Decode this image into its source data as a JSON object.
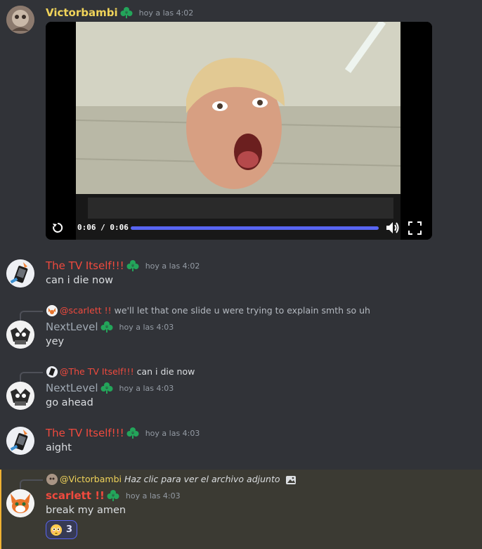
{
  "messages": [
    {
      "author": "Victorbambi",
      "author_color": "#f0d35a",
      "timestamp": "hoy a las 4:02",
      "video": {
        "current_time": "0:06",
        "separator": "/",
        "duration": "0:06",
        "progress": 1.0
      }
    },
    {
      "author": "The TV Itself!!!",
      "author_color": "#f04a3e",
      "timestamp": "hoy a las 4:02",
      "text": "can i die now"
    },
    {
      "reply": {
        "name": "@scarlett !!",
        "name_color": "#f04a3e",
        "text": "we'll let that one slide u were trying to explain smth so uh"
      },
      "author": "NextLevel",
      "author_color": "#a0a9b3",
      "timestamp": "hoy a las 4:03",
      "text": "yey"
    },
    {
      "reply": {
        "name": "@The TV Itself!!!",
        "name_color": "#f04a3e",
        "text": "can i die now"
      },
      "author": "NextLevel",
      "author_color": "#a0a9b3",
      "timestamp": "hoy a las 4:03",
      "text": "go ahead"
    },
    {
      "author": "The TV Itself!!!",
      "author_color": "#f04a3e",
      "timestamp": "hoy a las 4:03",
      "text": "aight"
    },
    {
      "reply": {
        "name": "@Victorbambi",
        "name_color": "#f0d35a",
        "text": "Haz clic para ver el archivo adjunto"
      },
      "author": "scarlett !!",
      "author_color": "#f04a3e",
      "timestamp": "hoy a las 4:03",
      "text": "break my amen",
      "reaction": {
        "emoji": "flushed-face",
        "count": "3"
      }
    }
  ],
  "colors": {
    "accent": "#5865f2",
    "badge": "#23a55a",
    "mention_highlight": "#f0b232"
  }
}
